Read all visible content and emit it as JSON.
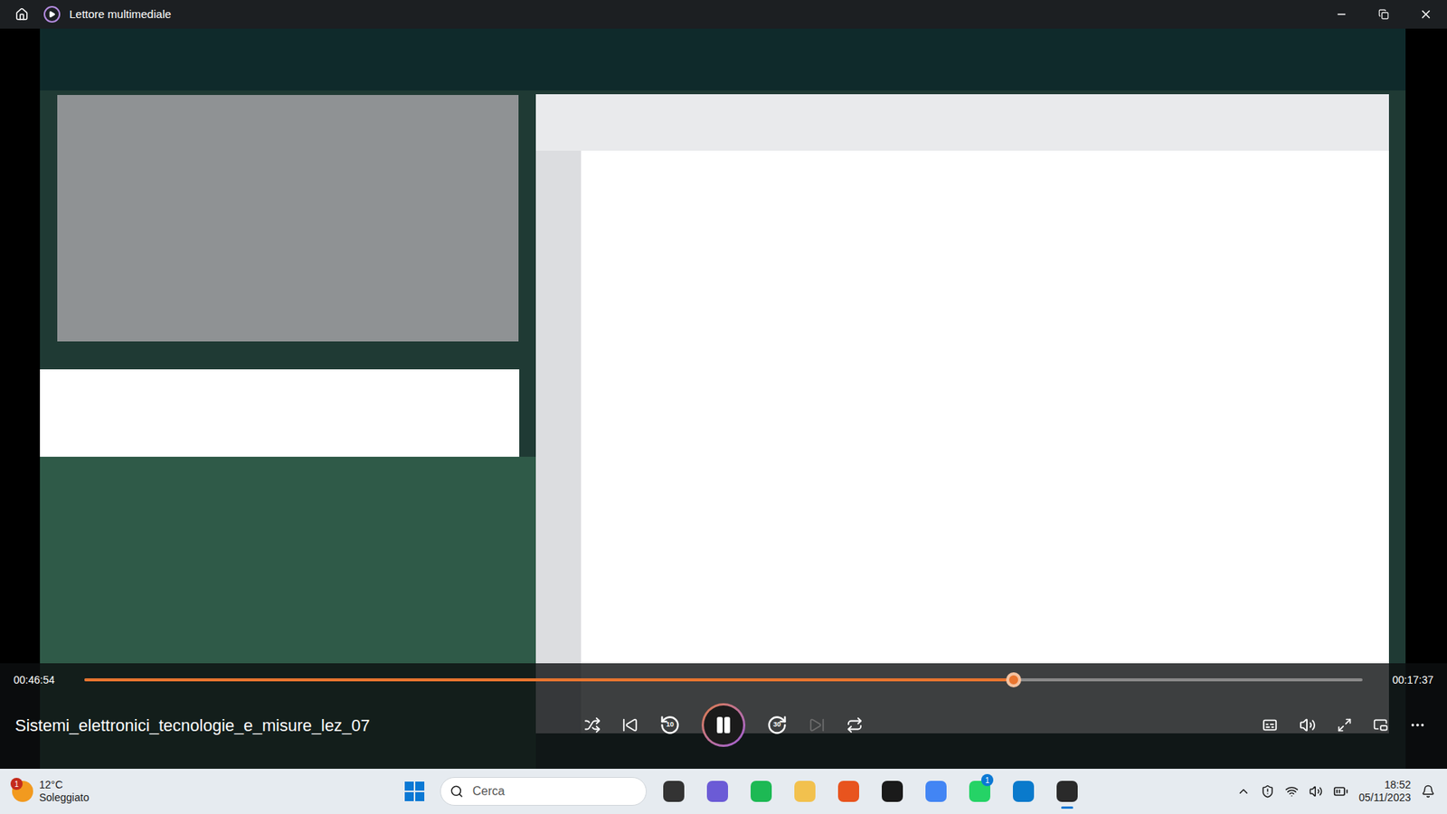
{
  "window": {
    "title": "Lettore multimediale"
  },
  "player": {
    "elapsed": "00:46:54",
    "remaining": "00:17:37",
    "level": 0.727,
    "playing": true,
    "file_title": "Sistemi_elettronici_tecnologie_e_misure_lez_07",
    "skip_back": "10",
    "skip_forward": "30",
    "next_disabled": true
  },
  "taskbar": {
    "weather": {
      "temp": "12°C",
      "condition": "Soleggiato",
      "badge": "1"
    },
    "search": {
      "placeholder": "Cerca"
    },
    "apps": [
      {
        "color": "#333333",
        "badge": "",
        "active": false
      },
      {
        "color": "#6b5bd6",
        "badge": "",
        "active": false
      },
      {
        "color": "#1db954",
        "badge": "",
        "active": false
      },
      {
        "color": "#f2c14e",
        "badge": "",
        "active": false
      },
      {
        "color": "#e8541e",
        "badge": "",
        "active": false
      },
      {
        "color": "#1a1a1a",
        "badge": "",
        "active": false
      },
      {
        "color": "#4285f4",
        "badge": "",
        "active": false
      },
      {
        "color": "#25d366",
        "badge": "1",
        "active": false
      },
      {
        "color": "#0a7acc",
        "badge": "",
        "active": false
      },
      {
        "color": "#2a2a2a",
        "badge": "",
        "active": true
      }
    ],
    "clock": {
      "time": "18:52",
      "date": "05/11/2023"
    }
  }
}
